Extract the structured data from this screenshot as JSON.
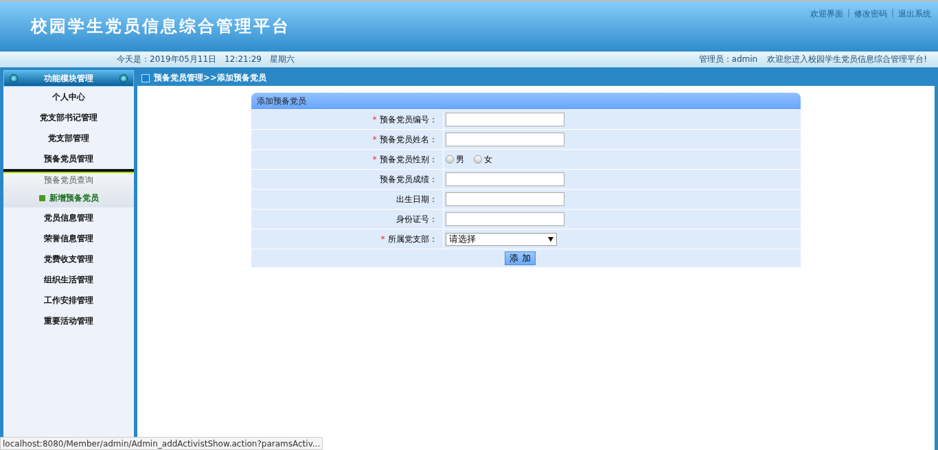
{
  "header": {
    "title": "校园学生党员信息综合管理平台",
    "links": [
      "欢迎界面",
      "修改密码",
      "退出系统"
    ],
    "separator": "|"
  },
  "info_bar": {
    "date": "今天是：2019年05月11日　12:21:29　星期六",
    "admin": "管理员：admin",
    "welcome": "欢迎您进入校园学生党员信息综合管理平台!"
  },
  "sidebar": {
    "title": "功能模块管理",
    "items": [
      {
        "label": "个人中心"
      },
      {
        "label": "党支部书记管理"
      },
      {
        "label": "党支部管理"
      },
      {
        "label": "预备党员管理",
        "children": [
          {
            "label": "预备党员查询",
            "selected": false
          },
          {
            "label": "新增预备党员",
            "selected": true
          }
        ]
      },
      {
        "label": "党员信息管理"
      },
      {
        "label": "荣誉信息管理"
      },
      {
        "label": "党费收支管理"
      },
      {
        "label": "组织生活管理"
      },
      {
        "label": "工作安排管理"
      },
      {
        "label": "重要活动管理"
      }
    ]
  },
  "breadcrumb": "预备党员管理>>添加预备党员",
  "form": {
    "title": "添加预备党员",
    "fields": [
      {
        "kind": "text",
        "label": "预备党员编号：",
        "required": true
      },
      {
        "kind": "text",
        "label": "预备党员姓名：",
        "required": true
      },
      {
        "kind": "radio",
        "label": "预备党员性别：",
        "required": true,
        "options": [
          {
            "label": "男",
            "selected": false
          },
          {
            "label": "女",
            "selected": false
          }
        ]
      },
      {
        "kind": "text",
        "label": "预备党员成绩：",
        "required": false
      },
      {
        "kind": "text",
        "label": "出生日期：",
        "required": false
      },
      {
        "kind": "text",
        "label": "身份证号：",
        "required": false
      },
      {
        "kind": "select",
        "label": "所属党支部：",
        "required": true,
        "value": "请选择"
      }
    ],
    "submit": "添 加",
    "required_mark": "*"
  },
  "status_url": "localhost:8080/Member/admin/Admin_addActivistShow.action?paramsActiv..."
}
